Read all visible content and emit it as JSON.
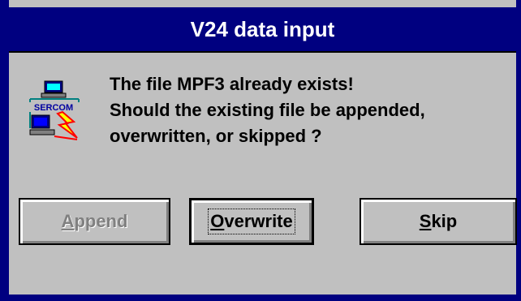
{
  "window": {
    "title": "V24 data input"
  },
  "message": {
    "lines": [
      "The file MPF3 already exists!",
      "Should the existing file be appended,",
      "overwritten, or skipped ?"
    ]
  },
  "icon": {
    "name": "sercom-icon",
    "label": "SERCOM"
  },
  "buttons": {
    "append": {
      "mnemonic": "A",
      "rest": "ppend"
    },
    "overwrite": {
      "mnemonic": "O",
      "rest": "verwrite"
    },
    "skip": {
      "mnemonic": "S",
      "rest": "kip"
    }
  },
  "colors": {
    "titlebar": "#000080",
    "face": "#c0c0c0",
    "disabled_text": "#808080"
  }
}
